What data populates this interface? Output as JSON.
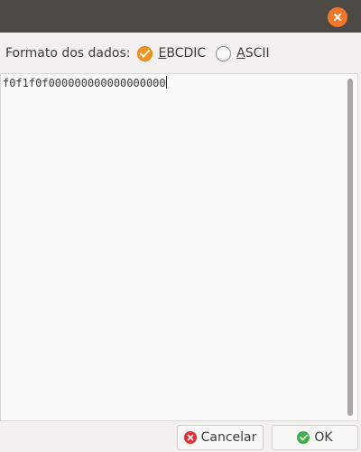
{
  "titlebar": {
    "close_icon": "close-icon",
    "close_color": "#f0772c",
    "background": "#4d4a46"
  },
  "format": {
    "label": "Formato dos dados:",
    "options": [
      {
        "mnemonic": "E",
        "rest": "BCDIC",
        "checked": true
      },
      {
        "mnemonic": "A",
        "rest": "SCII",
        "checked": false
      }
    ],
    "accent_color": "#f39321"
  },
  "editor": {
    "content": "f0f1f0f000000000000000000"
  },
  "buttons": {
    "cancel_label": "Cancelar",
    "cancel_icon": "cancel-icon",
    "ok_label": "OK",
    "ok_icon": "check-icon"
  }
}
